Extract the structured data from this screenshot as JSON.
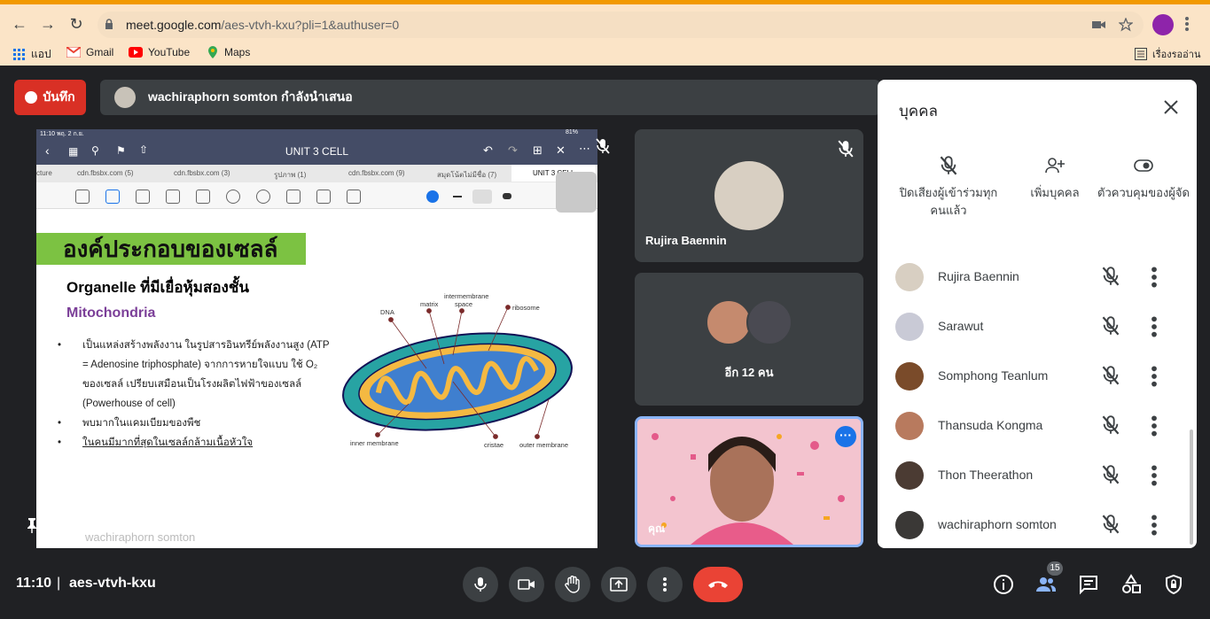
{
  "browser": {
    "url_host": "meet.google.com",
    "url_path": "/aes-vtvh-kxu?pli=1&authuser=0",
    "bookmarks": [
      {
        "label": "แอป",
        "icon": "apps-grid-icon"
      },
      {
        "label": "Gmail",
        "icon": "gmail-icon"
      },
      {
        "label": "YouTube",
        "icon": "youtube-icon"
      },
      {
        "label": "Maps",
        "icon": "maps-icon"
      }
    ],
    "reading_list": "เรื่องรออ่าน"
  },
  "meeting": {
    "record_label": "บันทึก",
    "presenter_banner": "wachiraphorn somton กำลังนำเสนอ",
    "time": "11:10",
    "code": "aes-vtvh-kxu",
    "participant_count": "15"
  },
  "slide": {
    "status_time": "11:10  พฤ. 2 ก.ย.",
    "battery": "81%",
    "title": "UNIT 3 CELL",
    "tabs": [
      "cture",
      "cdn.fbsbx.com (5)",
      "cdn.fbsbx.com (3)",
      "รูปภาพ (1)",
      "cdn.fbsbx.com (9)",
      "สมุดโน้ตไม่มีชื่อ (7)",
      "UNIT 3 CELL"
    ],
    "header": "องค์ประกอบของเซลล์",
    "subheader": "Organelle ที่มีเยื่อหุ้มสองชั้น",
    "organelle": "Mitochondria",
    "bullets": [
      "เป็นแหล่งสร้างพลังงาน ในรูปสารอินทรีย์พลังงานสูง (ATP = Adenosine triphosphate) จากการหายใจแบบ ใช้ O₂ ของเซลล์ เปรียบเสมือนเป็นโรงผลิตไฟฟ้าของเซลล์ (Powerhouse of cell)",
      "พบมากในแคมเบียมของพืช",
      "ในคนมีมากที่สุดในเซลล์กล้ามเนื้อหัวใจ"
    ],
    "diagram_labels": {
      "intermembrane": "intermembrane",
      "space": "space",
      "matrix": "matrix",
      "dna": "DNA",
      "ribosome": "ribosome",
      "inner_membrane": "inner membrane",
      "cristae": "cristae",
      "outer_membrane": "outer membrane"
    },
    "watermark": "wachiraphorn somton"
  },
  "tiles": {
    "tile1_name": "Rujira Baennin",
    "tile2_name": "อีก 12 คน",
    "self_name": "คุณ"
  },
  "panel": {
    "title": "บุคคล",
    "actions": [
      {
        "label": "ปิดเสียงผู้เข้าร่วมทุกคนแล้ว",
        "icon": "mic-off-icon"
      },
      {
        "label": "เพิ่มบุคคล",
        "icon": "person-add-icon"
      },
      {
        "label": "ตัวควบคุมของผู้จัด",
        "icon": "toggle-icon"
      }
    ],
    "people": [
      {
        "name": "Rujira Baennin",
        "color": "#d8cfc2"
      },
      {
        "name": "Sarawut",
        "color": "#c9cad6"
      },
      {
        "name": "Somphong Teanlum",
        "color": "#7a4b2a"
      },
      {
        "name": "Thansuda Kongma",
        "color": "#b87a5e"
      },
      {
        "name": "Thon Theerathon",
        "color": "#4b3b33"
      },
      {
        "name": "wachiraphorn somton",
        "color": "#3a3836"
      }
    ]
  }
}
